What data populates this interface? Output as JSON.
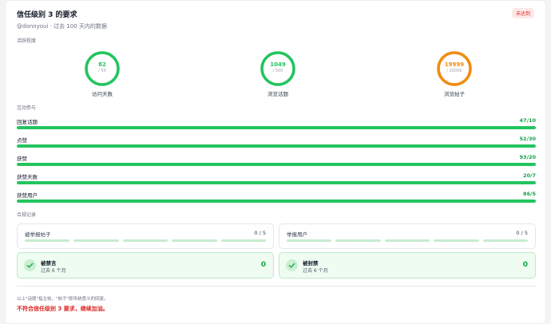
{
  "header": {
    "title": "信任级别 3 的要求",
    "status_badge": "未达到",
    "subtitle": "@donnyoui · 过去 100 天内的数据"
  },
  "colors": {
    "ok": "#22c55e",
    "warn": "#f28c0f",
    "fail": "#dc2626"
  },
  "activity": {
    "section_label": "活跃程度",
    "rings": [
      {
        "value": "82",
        "max": "/ 50",
        "label": "访问天数",
        "fraction": 1.0,
        "status": "ok"
      },
      {
        "value": "1049",
        "max": "/ 500",
        "label": "浏览话题",
        "fraction": 1.0,
        "status": "ok"
      },
      {
        "value": "19999",
        "max": "/ 20000",
        "label": "浏览帖子",
        "fraction": 0.99995,
        "status": "warn"
      }
    ]
  },
  "interaction": {
    "section_label": "互动参与",
    "rows": [
      {
        "label": "回复话题",
        "value": "47/10",
        "fraction": 1.0
      },
      {
        "label": "点赞",
        "value": "52/30",
        "fraction": 1.0
      },
      {
        "label": "获赞",
        "value": "93/20",
        "fraction": 1.0
      },
      {
        "label": "获赞天数",
        "value": "20/7",
        "fraction": 1.0
      },
      {
        "label": "获赞用户",
        "value": "86/5",
        "fraction": 1.0
      }
    ]
  },
  "compliance": {
    "section_label": "合规记录",
    "reported_posts": {
      "label": "被举报帖子",
      "count": "0 / 5"
    },
    "reported_users": {
      "label": "举报用户",
      "count": "0 / 5"
    },
    "silenced": {
      "title": "被禁言",
      "period": "过去 6 个月",
      "value": "0"
    },
    "suspended": {
      "title": "被封禁",
      "period": "过去 6 个月",
      "value": "0"
    }
  },
  "footer": {
    "note": "以上\"话题\"指主帖，\"帖子\"即传统意义的回复。",
    "verdict": "不符合信任级别 3 要求，继续加油。"
  }
}
